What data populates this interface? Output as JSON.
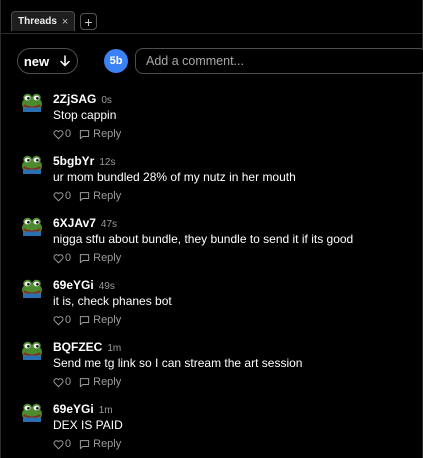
{
  "tabs": {
    "active_label": "Threads",
    "close_glyph": "×",
    "add_glyph": "+"
  },
  "toolbar": {
    "sort_label": "new",
    "sort_icon": "arrow-down-icon",
    "avatar_initials": "5b",
    "avatar_color": "#3b82f6",
    "comment_placeholder": "Add a comment..."
  },
  "comments": [
    {
      "user": "2ZjSAG",
      "time": "0s",
      "text": "Stop cappin",
      "likes": "0",
      "reply_label": "Reply"
    },
    {
      "user": "5bgbYr",
      "time": "12s",
      "text": "ur mom bundled 28% of my nutz in her mouth",
      "likes": "0",
      "reply_label": "Reply"
    },
    {
      "user": "6XJAv7",
      "time": "47s",
      "text": "nigga stfu about bundle, they bundle to send it if its good",
      "likes": "0",
      "reply_label": "Reply"
    },
    {
      "user": "69eYGi",
      "time": "49s",
      "text": "it is, check phanes bot",
      "likes": "0",
      "reply_label": "Reply"
    },
    {
      "user": "BQFZEC",
      "time": "1m",
      "text": "Send me tg link so I can stream the art session",
      "likes": "0",
      "reply_label": "Reply"
    },
    {
      "user": "69eYGi",
      "time": "1m",
      "text": "DEX IS PAID",
      "likes": "0",
      "reply_label": "Reply"
    }
  ]
}
